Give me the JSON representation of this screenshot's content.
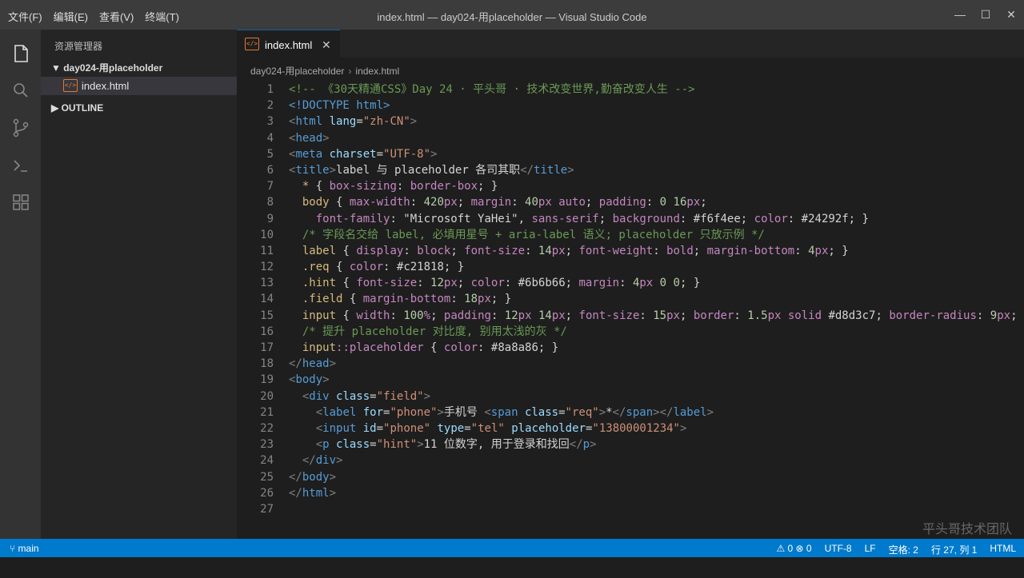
{
  "menu": [
    "文件(F)",
    "编辑(E)",
    "查看(V)",
    "终端(T)"
  ],
  "window_title": "index.html — day024-用placeholder — Visual Studio Code",
  "window_buttons": {
    "minimize": "—",
    "maximize": "☐",
    "close": "✕"
  },
  "sidebar": {
    "title": "资源管理器",
    "folder": "▼ day024-用placeholder",
    "file": "index.html",
    "outline": "▶ OUTLINE"
  },
  "tab": {
    "label": "index.html",
    "close": "✕"
  },
  "breadcrumb": [
    "day024-用placeholder",
    "index.html"
  ],
  "colors": {
    "comment": "#6a9955",
    "tag": "#569cd6",
    "attr": "#9cdcfe",
    "string": "#ce9178",
    "selector": "#d7ba7d",
    "property": "#c586c0",
    "number": "#b5cea8",
    "text": "#d4d4d4",
    "statusbar": "#007acc"
  },
  "code_lines": [
    [
      [
        "c",
        "<!-- 《30天精通CSS》Day 24 · 平头哥 · 技术改变世界,勤奋改变人生 -->"
      ]
    ],
    [
      [
        "g",
        "<!DOCTYPE html>"
      ]
    ],
    [
      [
        "g",
        "<"
      ],
      [
        "t",
        "html"
      ],
      [
        "a",
        " lang"
      ],
      [
        "p",
        "="
      ],
      [
        "s",
        "\"zh-CN\""
      ],
      [
        "g",
        ">"
      ]
    ],
    [
      [
        "g",
        "<"
      ],
      [
        "t",
        "head"
      ],
      [
        "g",
        ">"
      ]
    ],
    [
      [
        "g",
        "<"
      ],
      [
        "t",
        "meta"
      ],
      [
        "a",
        " charset"
      ],
      [
        "p",
        "="
      ],
      [
        "s",
        "\"UTF-8\""
      ],
      [
        "g",
        ">"
      ]
    ],
    [
      [
        "g",
        "<"
      ],
      [
        "t",
        "title"
      ],
      [
        "g",
        ">"
      ],
      [
        "p",
        "label 与 placeholder 各司其职"
      ],
      [
        "g",
        "</"
      ],
      [
        "t",
        "title"
      ],
      [
        "g",
        ">"
      ]
    ],
    [
      [
        "p",
        "  "
      ],
      [
        "k",
        "*"
      ],
      [
        "p",
        " { "
      ],
      [
        "r",
        "box-sizing"
      ],
      [
        "p",
        ": "
      ],
      [
        "r",
        "border-box"
      ],
      [
        "p",
        "; }"
      ]
    ],
    [
      [
        "p",
        "  "
      ],
      [
        "k",
        "body"
      ],
      [
        "p",
        " { "
      ],
      [
        "r",
        "max-width"
      ],
      [
        "p",
        ": "
      ],
      [
        "n",
        "420"
      ],
      [
        "r",
        "px"
      ],
      [
        "p",
        "; "
      ],
      [
        "r",
        "margin"
      ],
      [
        "p",
        ": "
      ],
      [
        "n",
        "40"
      ],
      [
        "r",
        "px"
      ],
      [
        "p",
        " "
      ],
      [
        "r",
        "auto"
      ],
      [
        "p",
        "; "
      ],
      [
        "r",
        "padding"
      ],
      [
        "p",
        ": "
      ],
      [
        "n",
        "0"
      ],
      [
        "p",
        " "
      ],
      [
        "n",
        "16"
      ],
      [
        "r",
        "px"
      ],
      [
        "p",
        ";"
      ]
    ],
    [
      [
        "p",
        "    "
      ],
      [
        "r",
        "font-family"
      ],
      [
        "p",
        ": "
      ],
      [
        "p",
        "\"Microsoft YaHei\""
      ],
      [
        "p",
        ", "
      ],
      [
        "r",
        "sans-serif"
      ],
      [
        "p",
        "; "
      ],
      [
        "r",
        "background"
      ],
      [
        "p",
        ": "
      ],
      [
        "p",
        "#f6f4ee"
      ],
      [
        "p",
        "; "
      ],
      [
        "r",
        "color"
      ],
      [
        "p",
        ": "
      ],
      [
        "p",
        "#24292f"
      ],
      [
        "p",
        "; }"
      ]
    ],
    [
      [
        "p",
        "  "
      ],
      [
        "c",
        "/* 字段名交给 label, 必填用星号 + aria-label 语义; placeholder 只放示例 */"
      ]
    ],
    [
      [
        "p",
        "  "
      ],
      [
        "k",
        "label"
      ],
      [
        "p",
        " { "
      ],
      [
        "r",
        "display"
      ],
      [
        "p",
        ": "
      ],
      [
        "r",
        "block"
      ],
      [
        "p",
        "; "
      ],
      [
        "r",
        "font-size"
      ],
      [
        "p",
        ": "
      ],
      [
        "n",
        "14"
      ],
      [
        "r",
        "px"
      ],
      [
        "p",
        "; "
      ],
      [
        "r",
        "font-weight"
      ],
      [
        "p",
        ": "
      ],
      [
        "r",
        "bold"
      ],
      [
        "p",
        "; "
      ],
      [
        "r",
        "margin-bottom"
      ],
      [
        "p",
        ": "
      ],
      [
        "n",
        "4"
      ],
      [
        "r",
        "px"
      ],
      [
        "p",
        "; }"
      ]
    ],
    [
      [
        "p",
        "  "
      ],
      [
        "k",
        ".req"
      ],
      [
        "p",
        " { "
      ],
      [
        "r",
        "color"
      ],
      [
        "p",
        ": "
      ],
      [
        "p",
        "#c21818"
      ],
      [
        "p",
        "; }"
      ]
    ],
    [
      [
        "p",
        "  "
      ],
      [
        "k",
        ".hint"
      ],
      [
        "p",
        " { "
      ],
      [
        "r",
        "font-size"
      ],
      [
        "p",
        ": "
      ],
      [
        "n",
        "12"
      ],
      [
        "r",
        "px"
      ],
      [
        "p",
        "; "
      ],
      [
        "r",
        "color"
      ],
      [
        "p",
        ": "
      ],
      [
        "p",
        "#6b6b66"
      ],
      [
        "p",
        "; "
      ],
      [
        "r",
        "margin"
      ],
      [
        "p",
        ": "
      ],
      [
        "n",
        "4"
      ],
      [
        "r",
        "px"
      ],
      [
        "p",
        " "
      ],
      [
        "n",
        "0"
      ],
      [
        "p",
        " "
      ],
      [
        "n",
        "0"
      ],
      [
        "p",
        "; }"
      ]
    ],
    [
      [
        "p",
        "  "
      ],
      [
        "k",
        ".field"
      ],
      [
        "p",
        " { "
      ],
      [
        "r",
        "margin-bottom"
      ],
      [
        "p",
        ": "
      ],
      [
        "n",
        "18"
      ],
      [
        "r",
        "px"
      ],
      [
        "p",
        "; }"
      ]
    ],
    [
      [
        "p",
        "  "
      ],
      [
        "k",
        "input"
      ],
      [
        "p",
        " { "
      ],
      [
        "r",
        "width"
      ],
      [
        "p",
        ": "
      ],
      [
        "n",
        "100"
      ],
      [
        "r",
        "%"
      ],
      [
        "p",
        "; "
      ],
      [
        "r",
        "padding"
      ],
      [
        "p",
        ": "
      ],
      [
        "n",
        "12"
      ],
      [
        "r",
        "px"
      ],
      [
        "p",
        " "
      ],
      [
        "n",
        "14"
      ],
      [
        "r",
        "px"
      ],
      [
        "p",
        "; "
      ],
      [
        "r",
        "font-size"
      ],
      [
        "p",
        ": "
      ],
      [
        "n",
        "15"
      ],
      [
        "r",
        "px"
      ],
      [
        "p",
        "; "
      ],
      [
        "r",
        "border"
      ],
      [
        "p",
        ": "
      ],
      [
        "n",
        "1.5"
      ],
      [
        "r",
        "px"
      ],
      [
        "p",
        " "
      ],
      [
        "r",
        "solid"
      ],
      [
        "p",
        " "
      ],
      [
        "p",
        "#d8d3c7"
      ],
      [
        "p",
        "; "
      ],
      [
        "r",
        "border-radius"
      ],
      [
        "p",
        ": "
      ],
      [
        "n",
        "9"
      ],
      [
        "r",
        "px"
      ],
      [
        "p",
        "; }"
      ]
    ],
    [
      [
        "p",
        "  "
      ],
      [
        "c",
        "/* 提升 placeholder 对比度, 别用太浅的灰 */"
      ]
    ],
    [
      [
        "p",
        "  "
      ],
      [
        "k",
        "input"
      ],
      [
        "r",
        "::placeholder"
      ],
      [
        "p",
        " { "
      ],
      [
        "r",
        "color"
      ],
      [
        "p",
        ": "
      ],
      [
        "p",
        "#8a8a86"
      ],
      [
        "p",
        "; }"
      ]
    ],
    [
      [
        "g",
        "</"
      ],
      [
        "t",
        "head"
      ],
      [
        "g",
        ">"
      ]
    ],
    [
      [
        "g",
        "<"
      ],
      [
        "t",
        "body"
      ],
      [
        "g",
        ">"
      ]
    ],
    [
      [
        "p",
        "  "
      ],
      [
        "g",
        "<"
      ],
      [
        "t",
        "div"
      ],
      [
        "a",
        " class"
      ],
      [
        "p",
        "="
      ],
      [
        "s",
        "\"field\""
      ],
      [
        "g",
        ">"
      ]
    ],
    [
      [
        "p",
        "    "
      ],
      [
        "g",
        "<"
      ],
      [
        "t",
        "label"
      ],
      [
        "a",
        " for"
      ],
      [
        "p",
        "="
      ],
      [
        "s",
        "\"phone\""
      ],
      [
        "g",
        ">"
      ],
      [
        "p",
        "手机号 "
      ],
      [
        "g",
        "<"
      ],
      [
        "t",
        "span"
      ],
      [
        "a",
        " class"
      ],
      [
        "p",
        "="
      ],
      [
        "s",
        "\"req\""
      ],
      [
        "g",
        ">"
      ],
      [
        "p",
        "*"
      ],
      [
        "g",
        "</"
      ],
      [
        "t",
        "span"
      ],
      [
        "g",
        "></"
      ],
      [
        "t",
        "label"
      ],
      [
        "g",
        ">"
      ]
    ],
    [
      [
        "p",
        "    "
      ],
      [
        "g",
        "<"
      ],
      [
        "t",
        "input"
      ],
      [
        "a",
        " id"
      ],
      [
        "p",
        "="
      ],
      [
        "s",
        "\"phone\""
      ],
      [
        "a",
        " type"
      ],
      [
        "p",
        "="
      ],
      [
        "s",
        "\"tel\""
      ],
      [
        "a",
        " placeholder"
      ],
      [
        "p",
        "="
      ],
      [
        "s",
        "\"13800001234\""
      ],
      [
        "g",
        ">"
      ]
    ],
    [
      [
        "p",
        "    "
      ],
      [
        "g",
        "<"
      ],
      [
        "t",
        "p"
      ],
      [
        "a",
        " class"
      ],
      [
        "p",
        "="
      ],
      [
        "s",
        "\"hint\""
      ],
      [
        "g",
        ">"
      ],
      [
        "p",
        "11 位数字, 用于登录和找回"
      ],
      [
        "g",
        "</"
      ],
      [
        "t",
        "p"
      ],
      [
        "g",
        ">"
      ]
    ],
    [
      [
        "p",
        "  "
      ],
      [
        "g",
        "</"
      ],
      [
        "t",
        "div"
      ],
      [
        "g",
        ">"
      ]
    ],
    [
      [
        "g",
        "</"
      ],
      [
        "t",
        "body"
      ],
      [
        "g",
        ">"
      ]
    ],
    [
      [
        "g",
        "</"
      ],
      [
        "t",
        "html"
      ],
      [
        "g",
        ">"
      ]
    ],
    []
  ],
  "watermark": "平头哥技术团队",
  "status": {
    "branch": "⑂ main",
    "problems": "⚠ 0  ⊗ 0",
    "encoding": "UTF-8",
    "eol": "LF",
    "indent": "空格: 2",
    "position": "行 27, 列 1",
    "language": "HTML"
  }
}
